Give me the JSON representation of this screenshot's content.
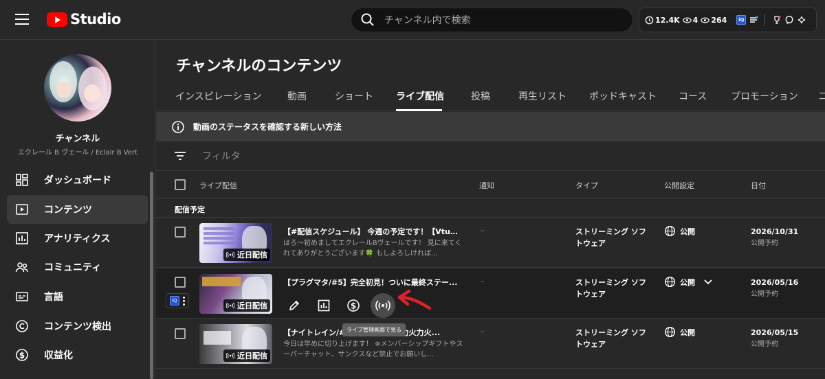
{
  "topbar": {
    "logo_text": "Studio",
    "search_placeholder": "チャンネル内で検索",
    "stats": {
      "views": "12.4K",
      "watching": "4",
      "viewers": "264"
    },
    "ext_badge": "iQ"
  },
  "sidebar": {
    "channel_label": "チャンネル",
    "channel_name": "エクレール B ヴェール / Eclair B Vert",
    "items": [
      {
        "label": "ダッシュボード",
        "icon": "dashboard-icon"
      },
      {
        "label": "コンテンツ",
        "icon": "content-icon",
        "active": true
      },
      {
        "label": "アナリティクス",
        "icon": "analytics-icon"
      },
      {
        "label": "コミュニティ",
        "icon": "community-icon"
      },
      {
        "label": "言語",
        "icon": "subtitles-icon"
      },
      {
        "label": "コンテンツ検出",
        "icon": "copyright-icon"
      },
      {
        "label": "収益化",
        "icon": "dollar-icon"
      }
    ]
  },
  "main": {
    "title": "チャンネルのコンテンツ",
    "tabs": [
      "インスピレーション",
      "動画",
      "ショート",
      "ライブ配信",
      "投稿",
      "再生リスト",
      "ポッドキャスト",
      "コース",
      "プロモーション",
      "コ"
    ],
    "notice": "動画のステータスを確認する新しい方法",
    "filter_placeholder": "フィルタ",
    "columns": {
      "stream": "ライブ配信",
      "notify": "通知",
      "type": "タイプ",
      "visibility": "公開設定",
      "date": "日付"
    },
    "section": "配信予定",
    "rows": [
      {
        "title": "【#配信スケジュール】 今週の予定です！【Vtub...",
        "desc": "はろ～初めましてエクレールBヴェールです！ 見に来てくれてありがとうございます🍀 もしよろしければ...",
        "badge": "近日配信",
        "notify": "–",
        "type_line1": "ストリーミング ソフ",
        "type_line2": "トウェア",
        "visibility": "公開",
        "date": "2026/10/31",
        "date_sub": "公開予約"
      },
      {
        "title": "【プラグマタ/#5】完全初見！ついに最終ステー...",
        "desc": "",
        "badge": "近日配信",
        "notify": "–",
        "type_line1": "ストリーミング ソフ",
        "type_line2": "トウェア",
        "visibility": "公開",
        "date": "2026/05/16",
        "date_sub": "公開予約",
        "tooltip": "ライブ管理画面で見る"
      },
      {
        "title": "【ナイトレイン/#85】火力火力火力火力火...",
        "desc": "今日は早めに切り上げます！ ※メンバーシップギフトやスーパーチャット、サンクスなど禁止でお願いし...",
        "badge": "近日配信",
        "notify": "–",
        "type_line1": "ストリーミング ソフ",
        "type_line2": "トウェア",
        "visibility": "公開",
        "date": "2026/05/15",
        "date_sub": "公開予約"
      }
    ]
  },
  "colors": {
    "accent_red": "#ff0000",
    "arrow_red": "#e0202a",
    "bg": "#282828"
  }
}
